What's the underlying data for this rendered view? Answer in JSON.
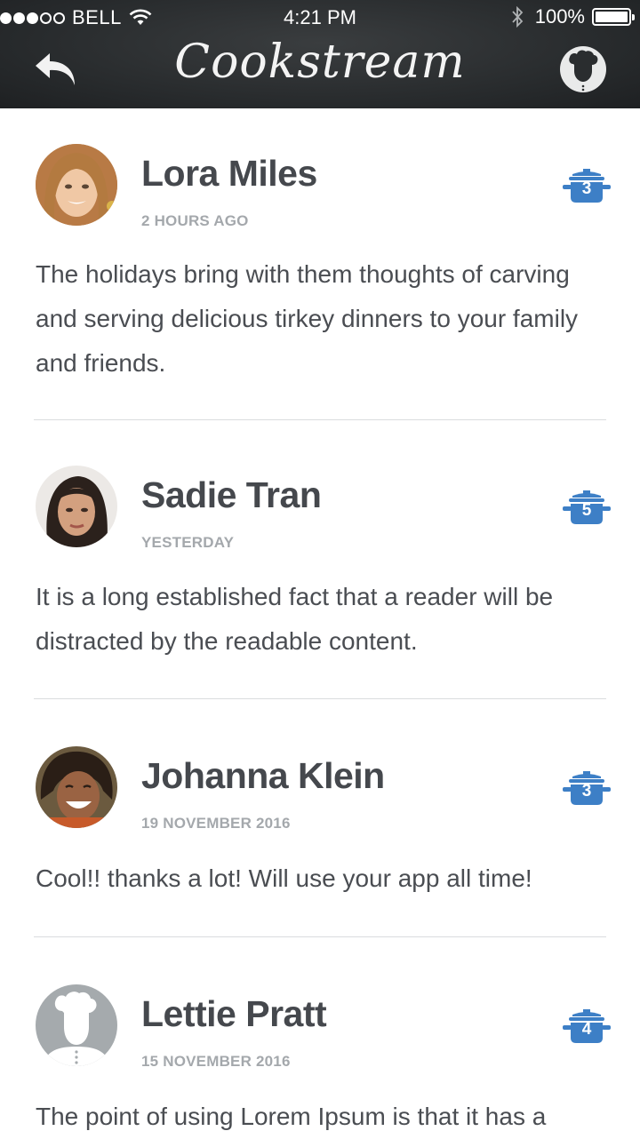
{
  "status_bar": {
    "carrier": "BELL",
    "time": "4:21 PM",
    "battery": "100%"
  },
  "header": {
    "title": "Cookstream",
    "back_icon": "back-arrow-icon",
    "profile_icon": "chef-hat-icon"
  },
  "colors": {
    "header_bg": "#2a2d2f",
    "badge_blue": "#3d7fc6",
    "text": "#4a4d52",
    "timestamp": "#a4a8ac"
  },
  "posts": [
    {
      "author": "Lora Miles",
      "time": "2 HOURS AGO",
      "text": "The holidays bring with them thoughts of carving and serving delicious tirkey dinners to your family and friends.",
      "count": "3",
      "avatar": "photo"
    },
    {
      "author": "Sadie Tran",
      "time": "YESTERDAY",
      "text": "It is a long established fact that a reader will be distracted by the readable content.",
      "count": "5",
      "avatar": "photo"
    },
    {
      "author": "Johanna Klein",
      "time": "19 NOVEMBER 2016",
      "text": "Cool!! thanks a lot! Will use your app all time!",
      "count": "3",
      "avatar": "photo"
    },
    {
      "author": "Lettie Pratt",
      "time": "15 NOVEMBER 2016",
      "text": "The point of using Lorem Ipsum is that it has a",
      "count": "4",
      "avatar": "chef-placeholder"
    }
  ]
}
